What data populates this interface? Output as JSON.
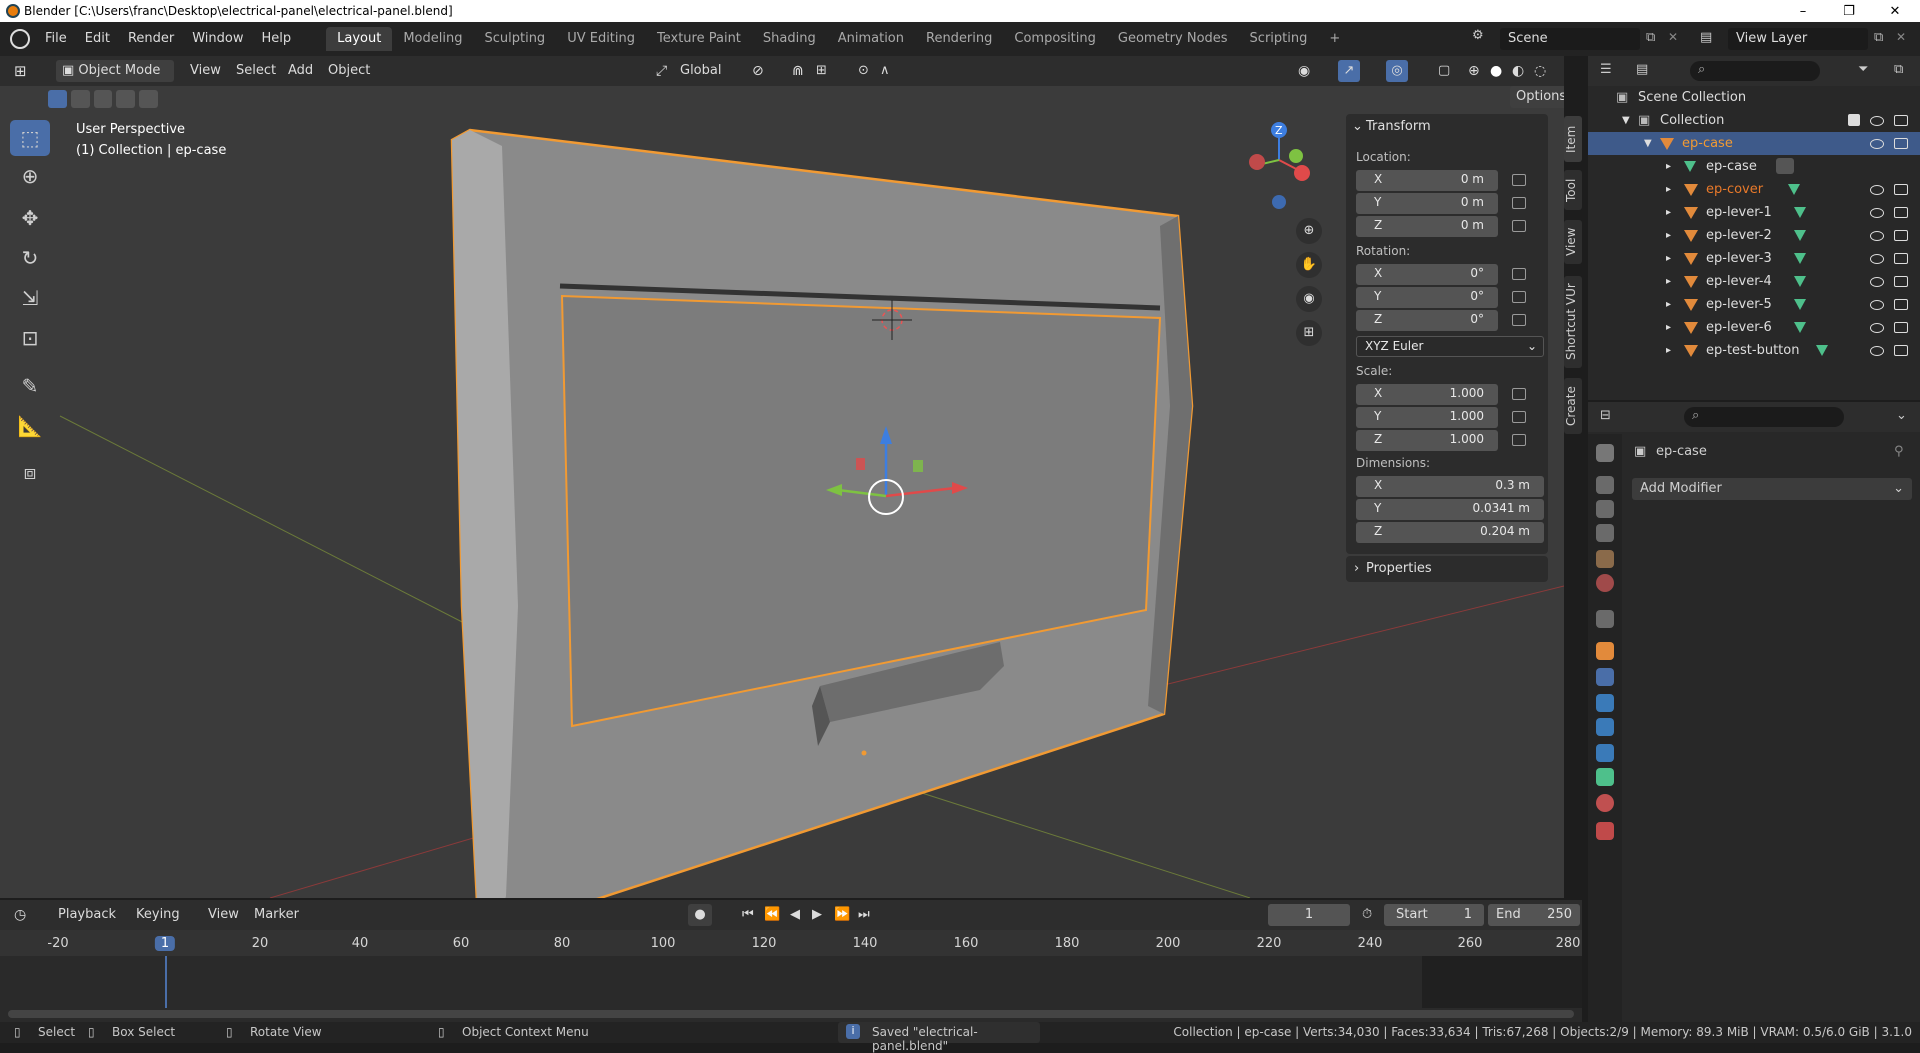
{
  "window": {
    "title": "Blender [C:\\Users\\franc\\Desktop\\electrical-panel\\electrical-panel.blend]",
    "minimize": "–",
    "maximize": "❐",
    "close": "✕"
  },
  "menubar": {
    "items": [
      "File",
      "Edit",
      "Render",
      "Window",
      "Help"
    ],
    "workspaces": [
      "Layout",
      "Modeling",
      "Sculpting",
      "UV Editing",
      "Texture Paint",
      "Shading",
      "Animation",
      "Rendering",
      "Compositing",
      "Geometry Nodes",
      "Scripting"
    ],
    "active_workspace": "Layout",
    "add_workspace": "+",
    "scene": "Scene",
    "view_layer": "View Layer"
  },
  "viewport": {
    "mode": "Object Mode",
    "menus": [
      "View",
      "Select",
      "Add",
      "Object"
    ],
    "transform_orientation": "Global",
    "options": "Options",
    "perspective_label": "User Perspective",
    "collection_label": "(1) Collection | ep-case",
    "gizmo_axes": {
      "z": "Z",
      "y": "Y",
      "x": "X"
    }
  },
  "npanel": {
    "transform_header": "Transform",
    "location_label": "Location:",
    "location": [
      {
        "axis": "X",
        "value": "0 m"
      },
      {
        "axis": "Y",
        "value": "0 m"
      },
      {
        "axis": "Z",
        "value": "0 m"
      }
    ],
    "rotation_label": "Rotation:",
    "rotation": [
      {
        "axis": "X",
        "value": "0°"
      },
      {
        "axis": "Y",
        "value": "0°"
      },
      {
        "axis": "Z",
        "value": "0°"
      }
    ],
    "rotation_mode": "XYZ Euler",
    "scale_label": "Scale:",
    "scale": [
      {
        "axis": "X",
        "value": "1.000"
      },
      {
        "axis": "Y",
        "value": "1.000"
      },
      {
        "axis": "Z",
        "value": "1.000"
      }
    ],
    "dimensions_label": "Dimensions:",
    "dimensions": [
      {
        "axis": "X",
        "value": "0.3 m"
      },
      {
        "axis": "Y",
        "value": "0.0341 m"
      },
      {
        "axis": "Z",
        "value": "0.204 m"
      }
    ],
    "properties_header": "Properties",
    "tabs": [
      "Item",
      "Tool",
      "View",
      "Shortcut VUr",
      "Create"
    ]
  },
  "outliner": {
    "scene_collection": "Scene Collection",
    "collection": "Collection",
    "items": [
      {
        "name": "ep-case",
        "level": 1,
        "selected": true
      },
      {
        "name": "ep-case",
        "level": 2
      },
      {
        "name": "ep-cover",
        "level": 2,
        "active": true
      },
      {
        "name": "ep-lever-1",
        "level": 2
      },
      {
        "name": "ep-lever-2",
        "level": 2
      },
      {
        "name": "ep-lever-3",
        "level": 2
      },
      {
        "name": "ep-lever-4",
        "level": 2
      },
      {
        "name": "ep-lever-5",
        "level": 2
      },
      {
        "name": "ep-lever-6",
        "level": 2
      },
      {
        "name": "ep-test-button",
        "level": 2
      }
    ]
  },
  "properties": {
    "object_name": "ep-case",
    "add_modifier": "Add Modifier"
  },
  "timeline": {
    "menus": [
      "Playback",
      "Keying",
      "View",
      "Marker"
    ],
    "current_frame": "1",
    "start_label": "Start",
    "start": "1",
    "end_label": "End",
    "end": "250",
    "ticks": [
      "-20",
      "1",
      "20",
      "40",
      "60",
      "80",
      "100",
      "120",
      "140",
      "160",
      "180",
      "200",
      "220",
      "240",
      "260",
      "280"
    ]
  },
  "statusbar": {
    "select": "Select",
    "box_select": "Box Select",
    "rotate_view": "Rotate View",
    "context_menu": "Object Context Menu",
    "saved_message": "Saved \"electrical-panel.blend\"",
    "stats": "Collection | ep-case | Verts:34,030 | Faces:33,634 | Tris:67,268 | Objects:2/9 | Memory: 89.3 MiB | VRAM: 0.5/6.0 GiB | 3.1.0"
  },
  "colors": {
    "accent_blue": "#4a6ea8",
    "selection_orange": "#f19a33",
    "active_text_orange": "#e8792a",
    "axis_x": "#e04a4a",
    "axis_y": "#7ec242",
    "axis_z": "#3d7ee0"
  }
}
